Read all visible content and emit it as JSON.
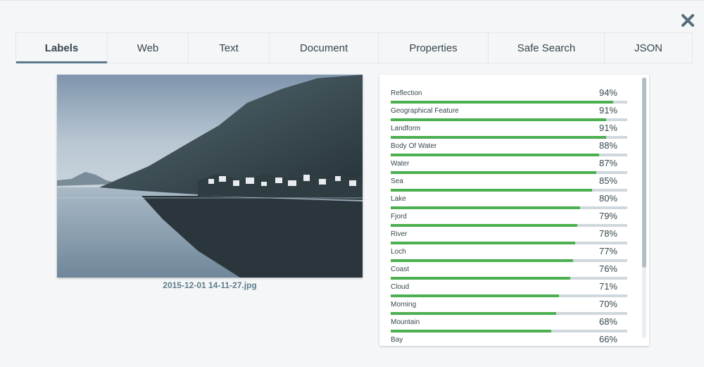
{
  "tabs": [
    {
      "label": "Labels",
      "active": true
    },
    {
      "label": "Web",
      "active": false
    },
    {
      "label": "Text",
      "active": false
    },
    {
      "label": "Document",
      "active": false
    },
    {
      "label": "Properties",
      "active": false
    },
    {
      "label": "Safe Search",
      "active": false
    },
    {
      "label": "JSON",
      "active": false
    }
  ],
  "close_icon": "close-icon",
  "image": {
    "filename": "2015-12-01 14-11-27.jpg"
  },
  "labels": [
    {
      "name": "Reflection",
      "percent": "94%",
      "value": 94
    },
    {
      "name": "Geographical Feature",
      "percent": "91%",
      "value": 91
    },
    {
      "name": "Landform",
      "percent": "91%",
      "value": 91
    },
    {
      "name": "Body Of Water",
      "percent": "88%",
      "value": 88
    },
    {
      "name": "Water",
      "percent": "87%",
      "value": 87
    },
    {
      "name": "Sea",
      "percent": "85%",
      "value": 85
    },
    {
      "name": "Lake",
      "percent": "80%",
      "value": 80
    },
    {
      "name": "Fjord",
      "percent": "79%",
      "value": 79
    },
    {
      "name": "River",
      "percent": "78%",
      "value": 78
    },
    {
      "name": "Loch",
      "percent": "77%",
      "value": 77
    },
    {
      "name": "Coast",
      "percent": "76%",
      "value": 76
    },
    {
      "name": "Cloud",
      "percent": "71%",
      "value": 71
    },
    {
      "name": "Morning",
      "percent": "70%",
      "value": 70
    },
    {
      "name": "Mountain",
      "percent": "68%",
      "value": 68
    },
    {
      "name": "Bay",
      "percent": "66%",
      "value": 66
    }
  ],
  "colors": {
    "bar_fill": "#4caf50",
    "bar_track": "#cfd8dc",
    "active_tab_underline": "#5b7a8e"
  }
}
